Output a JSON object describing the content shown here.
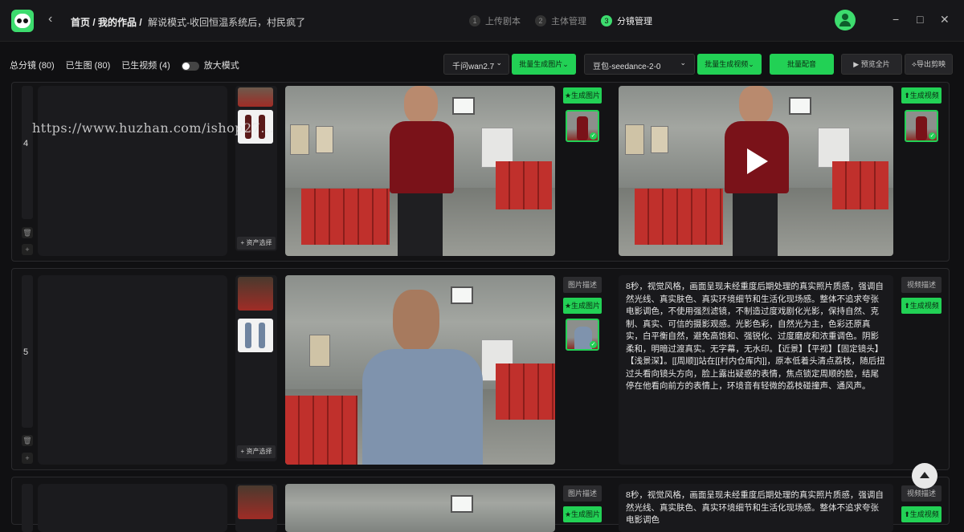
{
  "header": {
    "breadcrumb_home": "首页",
    "breadcrumb_sep1": "/",
    "breadcrumb_works": "我的作品",
    "breadcrumb_sep2": "/",
    "project_title": "解说模式-收回恒温系统后，村民疯了",
    "steps": [
      {
        "num": "1",
        "label": "上传剧本"
      },
      {
        "num": "2",
        "label": "主体管理"
      },
      {
        "num": "3",
        "label": "分镜管理"
      }
    ],
    "window_controls": {
      "minimize": "−",
      "maximize": "□",
      "close": "✕"
    },
    "back_icon": "‹"
  },
  "toolbar": {
    "total_shots": "总分镜 (80)",
    "generated_images": "已生图 (80)",
    "generated_videos": "已生视频 (4)",
    "zoom_mode": "放大模式",
    "image_model": "千问wan2.7",
    "batch_image": "批量生成图片",
    "video_model": "豆包-seedance-2-0",
    "batch_video": "批量生成视频",
    "batch_voice": "批量配音",
    "preview_all": "▶ 预览全片",
    "export_edit": "⟡导出剪映"
  },
  "shots": [
    {
      "index": "4",
      "asset_select": "+ 资产选择",
      "gen_image": "生成图片",
      "gen_video": "生成视频",
      "gen_image_icon": "★",
      "gen_video_icon": "⬆"
    },
    {
      "index": "5",
      "asset_select": "+ 资产选择",
      "image_desc": "图片描述",
      "gen_image": "生成图片",
      "gen_image_icon": "★",
      "video_desc": "视频描述",
      "gen_video": "生成视频",
      "gen_video_icon": "⬆",
      "prompt": "8秒，视觉风格，画面呈现未经重度后期处理的真实照片质感，强调自然光线、真实肤色、真实环境细节和生活化现场感。整体不追求夸张电影调色，不使用强烈滤镜，不制造过度戏剧化光影，保持自然、克制、真实、可信的摄影观感。光影色彩，自然光为主，色彩还原真实，白平衡自然，避免高饱和、强锐化、过度磨皮和浓重调色。阴影柔和，明暗过渡真实。无字幕，无水印。【近景】【平视】【固定镜头】【浅景深】。[[周顺]]站在[[村内仓库内]]，原本低着头清点荔枝，随后扭过头看向镜头方向，脸上露出疑惑的表情，焦点锁定周顺的脸，结尾停在他看向前方的表情上，环境音有轻微的荔枝碰撞声、通风声。"
    },
    {
      "index": "",
      "image_desc": "图片描述",
      "gen_image": "生成图片",
      "gen_image_icon": "★",
      "video_desc": "视频描述",
      "gen_video": "生成视频",
      "gen_video_icon": "⬆",
      "prompt": "8秒，视觉风格，画面呈现未经重度后期处理的真实照片质感，强调自然光线、真实肤色、真实环境细节和生活化现场感。整体不追求夸张电影调色"
    }
  ],
  "watermark": "https://www.huzhan.com/ishop27..."
}
